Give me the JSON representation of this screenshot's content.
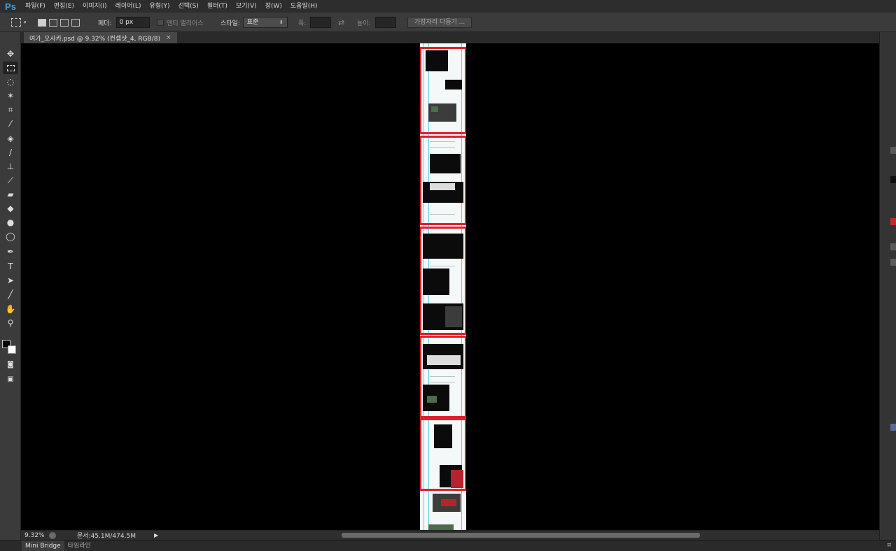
{
  "app": {
    "logo": "Ps"
  },
  "menu": [
    "파일(F)",
    "편집(E)",
    "이미지(I)",
    "레이어(L)",
    "유형(Y)",
    "선택(S)",
    "필터(T)",
    "보기(V)",
    "창(W)",
    "도움말(H)"
  ],
  "options": {
    "feather_label": "페더:",
    "feather_value": "0 px",
    "antialias_label": "앤티 앨리어스",
    "style_label": "스타일:",
    "style_value": "표준",
    "width_label": "폭:",
    "height_label": "높이:",
    "refine_edge_button": "가장자리 다듬기 ..."
  },
  "document_tab": {
    "title": "여가_오사카.psd @ 9.32% (컨셉샷_4, RGB/8)",
    "close": "×"
  },
  "status": {
    "zoom": "9.32%",
    "doc_info": "문서:45.1M/474.5M",
    "arrow": "▶"
  },
  "bottom_tabs": [
    "Mini Bridge",
    "타임라인"
  ],
  "colors": {
    "selection_border": "#e0202a",
    "guides": "#5fd3dd",
    "ui_bg": "#3b3b3b",
    "logo": "#3aa0e8"
  },
  "icons": {
    "toolbox": [
      "move-icon",
      "marquee-icon",
      "lasso-icon",
      "magic-wand-icon",
      "crop-icon",
      "eyedropper-icon",
      "healing-brush-icon",
      "brush-icon",
      "clone-stamp-icon",
      "history-brush-icon",
      "eraser-icon",
      "paint-bucket-icon",
      "blur-icon",
      "dodge-icon",
      "pen-icon",
      "type-icon",
      "path-selection-icon",
      "line-icon",
      "hand-icon",
      "zoom-icon"
    ]
  }
}
